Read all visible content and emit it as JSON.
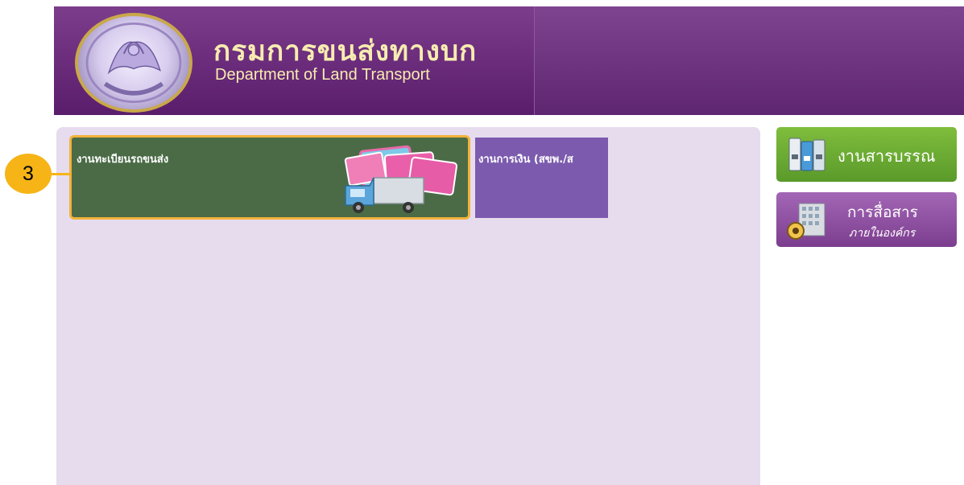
{
  "header": {
    "title_thai": "กรมการขนส่งทางบก",
    "title_en": "Department of Land Transport"
  },
  "tiles": [
    {
      "label": "งานทะเบียนรถขนส่ง"
    },
    {
      "label": "งานการเงิน (สขพ./ส"
    }
  ],
  "badge": {
    "number": "3"
  },
  "side_buttons": {
    "archive": {
      "label": "งานสารบรรณ"
    },
    "comm": {
      "label1": "การสื่อสาร",
      "label2": "ภายในองค์กร"
    }
  },
  "colors": {
    "header": "#6b2b7c",
    "panel": "#e6dcee",
    "tile_transport": "#4a6b46",
    "tile_finance": "#7c5bae",
    "highlight": "#f3b23a",
    "archive_btn": "#6aaa33",
    "comm_btn": "#8f4ea3"
  }
}
